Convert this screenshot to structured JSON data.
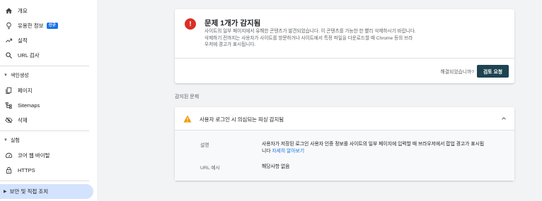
{
  "sidebar": {
    "overview": "개요",
    "insights": "유용한 정보",
    "insights_badge": "신규",
    "performance": "실적",
    "url_inspection": "URL 검사",
    "indexing_section": "색인생성",
    "pages": "페이지",
    "sitemaps": "Sitemaps",
    "removals": "삭제",
    "experience_section": "실험",
    "core_web_vitals": "코어 웹 바이탈",
    "https": "HTTPS",
    "security_section": "보안 및 직접 조치"
  },
  "issue": {
    "title": "문제 1개가 감지됨",
    "description": "사이트의 일부 페이지에서 유해한 콘텐츠가 발견되었습니다. 이 콘텐츠를 가능한 한 빨리 삭제하시기 바랍니다. 삭제하기 전까지는 사용자가 사이트를 방문하거나 사이트에서 특정 파일을 다운로드할 때 Chrome 등의 브라우저에 경고가 표시됩니다.",
    "resolved_question": "해결되었습니까?",
    "review_button": "검토 요청"
  },
  "detected": {
    "label": "감지된 문제",
    "item_title": "사용자 로그인 시 의심되는 피싱 감지됨",
    "desc_label": "설명",
    "desc_text": "사용자가 저장된 로그인 사용자 인증 정보를 사이트의 일부 페이지에 입력할 때 브라우저에서 팝업 경고가 표시됩니다",
    "learn_more": "자세히 알아보기",
    "url_label": "URL 예시",
    "url_value": "해당사항 없음"
  },
  "colors": {
    "accent": "#1a73e8",
    "error": "#d93025",
    "warning": "#f29900",
    "button": "#1e4351",
    "active_nav": "#d3e3fd"
  }
}
